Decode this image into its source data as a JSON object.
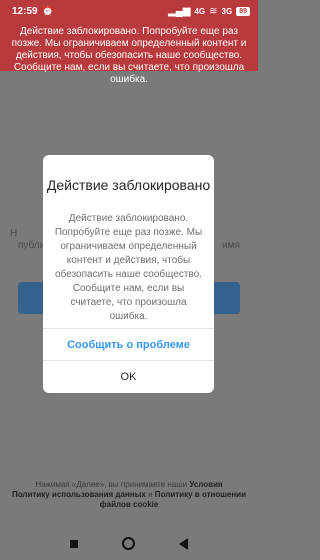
{
  "status_bar": {
    "time": "12:59",
    "signal_1": "4G",
    "signal_2": "3G",
    "battery": "89",
    "icons": [
      "alarm-clock-icon",
      "signal-icon",
      "wifi-icon",
      "battery-icon"
    ]
  },
  "toast": {
    "message": "Действие заблокировано. Попробуйте еще раз позже. Мы ограничиваем определенный контент и действия, чтобы обезопасить наше сообщество. Сообщите нам, если вы считаете, что произошла ошибка."
  },
  "background": {
    "left_fragment": "Н",
    "left_fragment_2": "публи",
    "right_fragment": "имя"
  },
  "dialog": {
    "title": "Действие заблокировано",
    "message": "Действие заблокировано. Попробуйте еще раз позже. Мы ограничиваем определенный контент и действия, чтобы обезопасить наше сообщество. Сообщите нам, если вы считаете, что произошла ошибка.",
    "report_button": "Сообщить о проблеме",
    "ok_button": "OK"
  },
  "footer": {
    "prefix": "Нажимая «Далее», вы принимаете наши",
    "terms": "Условия",
    "data_policy": "Политику использования данных",
    "and": "и",
    "cookie_policy": "Политику в отношении файлов cookie"
  },
  "colors": {
    "toast_bg": "#b83a3c",
    "link": "#3897f0",
    "bg_button": "#35618f"
  }
}
